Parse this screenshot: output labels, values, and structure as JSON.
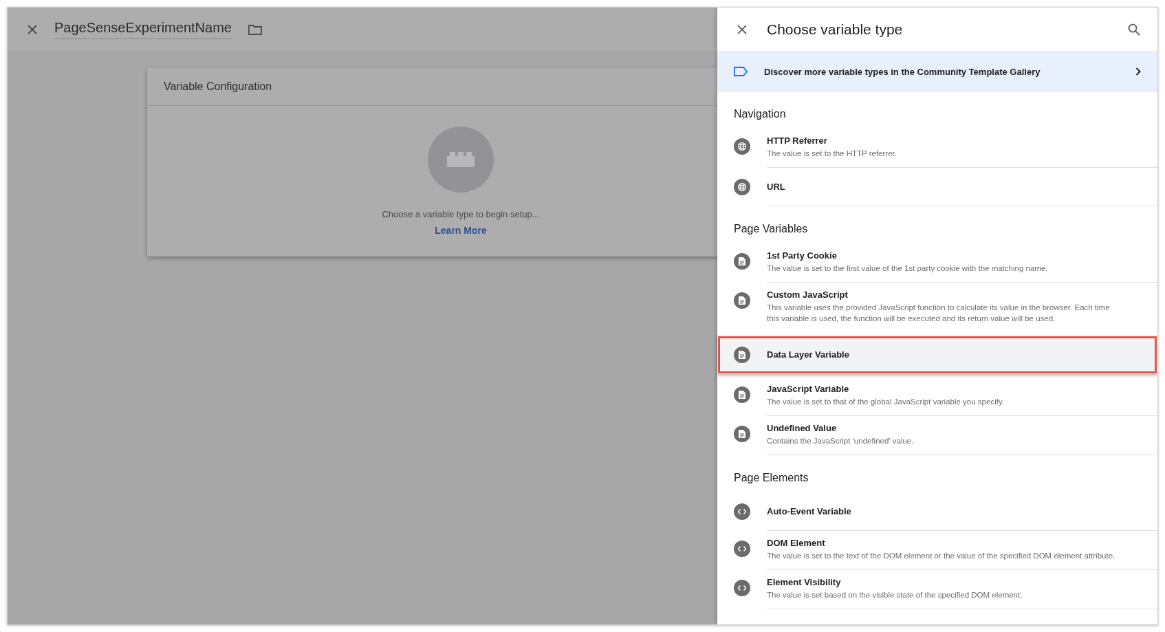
{
  "editor": {
    "name": "PageSenseExperimentName",
    "card_title": "Variable Configuration",
    "empty_text": "Choose a variable type to begin setup...",
    "link": "Learn More"
  },
  "panel": {
    "title": "Choose variable type",
    "banner": "Discover more variable types in the Community Template Gallery",
    "sections": [
      {
        "heading": "Navigation",
        "items": [
          {
            "kind": "globe",
            "title": "HTTP Referrer",
            "description": "The value is set to the HTTP referrer.",
            "selected": false
          },
          {
            "kind": "globe",
            "title": "URL",
            "selected": false
          }
        ]
      },
      {
        "heading": "Page Variables",
        "items": [
          {
            "kind": "document",
            "title": "1st Party Cookie",
            "description": "The value is set to the first value of the 1st party cookie with the matching name.",
            "selected": false
          },
          {
            "kind": "document",
            "title": "Custom JavaScript",
            "description": "This variable uses the provided JavaScript function to calculate its value in the browser. Each time this variable is used, the function will be executed and its return value will be used.",
            "selected": false
          },
          {
            "kind": "document",
            "title": "Data Layer Variable",
            "selected": true
          },
          {
            "kind": "document",
            "title": "JavaScript Variable",
            "description": "The value is set to that of the global JavaScript variable you specify.",
            "selected": false
          },
          {
            "kind": "document",
            "title": "Undefined Value",
            "description": "Contains the JavaScript 'undefined' value.",
            "selected": false
          }
        ]
      },
      {
        "heading": "Page Elements",
        "items": [
          {
            "kind": "code",
            "title": "Auto-Event Variable",
            "selected": false
          },
          {
            "kind": "code",
            "title": "DOM Element",
            "description": "The value is set to the text of the DOM element or the value of the specified DOM element attribute.",
            "selected": false
          },
          {
            "kind": "code",
            "title": "Element Visibility",
            "description": "The value is set based on the visible state of the specified DOM element.",
            "selected": false
          }
        ]
      }
    ]
  }
}
